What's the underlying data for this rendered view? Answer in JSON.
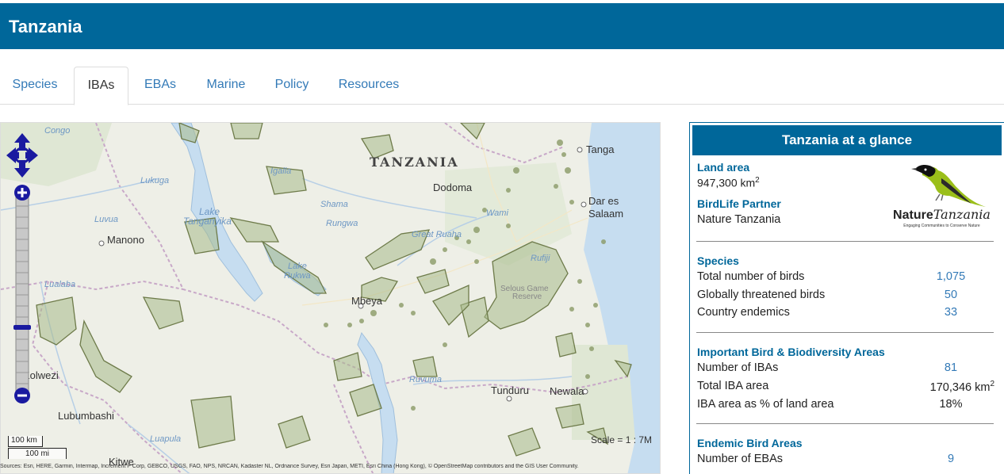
{
  "header": {
    "title": "Tanzania"
  },
  "tabs": [
    {
      "label": "Species",
      "active": false
    },
    {
      "label": "IBAs",
      "active": true
    },
    {
      "label": "EBAs",
      "active": false
    },
    {
      "label": "Marine",
      "active": false
    },
    {
      "label": "Policy",
      "active": false
    },
    {
      "label": "Resources",
      "active": false
    }
  ],
  "map": {
    "labels": {
      "country": "TANZANIA",
      "dodoma": "Dodoma",
      "tanga": "Tanga",
      "dar1": "Dar es",
      "dar2": "Salaam",
      "manono": "Manono",
      "mbeya": "Mbeya",
      "tunduru": "Tunduru",
      "newala": "Newala",
      "kolwezi": "Kolwezi",
      "lubumbashi": "Lubumbashi",
      "kitwe": "Kitwe",
      "lake_tanganyika1": "Lake",
      "lake_tanganyika2": "Tanganyika",
      "lake_rukwa1": "Lake",
      "lake_rukwa2": "Rukwa",
      "selous1": "Selous Game",
      "selous2": "Reserve",
      "lukuga": "Lukuga",
      "luvua": "Luvua",
      "igalla": "Igalla",
      "shama": "Shama",
      "rungwa": "Rungwa",
      "great_ruaha": "Great Ruaha",
      "wami": "Wami",
      "rufiji": "Rufiji",
      "ruvuma": "Ruvuma",
      "luapula": "Luapula",
      "lualaba": "Lualaba",
      "congo": "Congo"
    },
    "scale_km": "100 km",
    "scale_mi": "100 mi",
    "scale_text": "Scale = 1 : 7M",
    "attribution": "Sources: Esri, HERE, Garmin, Intermap, Increment P Corp, GEBCO, USGS, FAO, NPS, NRCAN, Kadaster NL, Ordnance Survey, Esri Japan, METI, Esri China (Hong Kong), © OpenStreetMap contributors and the GIS User Community."
  },
  "glance": {
    "title": "Tanzania at a glance",
    "land_area_label": "Land area",
    "land_area_value": "947,300 km",
    "land_area_unit_sup": "2",
    "partner_label": "BirdLife Partner",
    "partner_name": "Nature Tanzania",
    "logo": {
      "brand_bold": "Nature",
      "brand_italic": "Tanzania",
      "tagline": "Engaging Communities to Conserve Nature",
      "icon": "bird-icon"
    },
    "species": {
      "heading": "Species",
      "rows": [
        {
          "label": "Total number of birds",
          "value": "1,075"
        },
        {
          "label": "Globally threatened birds",
          "value": "50"
        },
        {
          "label": "Country endemics",
          "value": "33"
        }
      ]
    },
    "ibas": {
      "heading": "Important Bird & Biodiversity Areas",
      "rows": [
        {
          "label": "Number of IBAs",
          "value": "81"
        },
        {
          "label": "Total IBA area",
          "value": "170,346 km",
          "sup": "2"
        },
        {
          "label": "IBA area as % of land area",
          "value": "18%"
        }
      ]
    },
    "ebas": {
      "heading": "Endemic Bird Areas",
      "rows": [
        {
          "label": "Number of EBAs",
          "value": "9"
        }
      ]
    }
  },
  "colors": {
    "header_bg": "#00679a",
    "link": "#337ab7",
    "iba_fill": "#a8b98a",
    "iba_stroke": "#6e7b4a",
    "water": "#c6ddf0",
    "land": "#eeefe7",
    "zoom_control": "#1a1aa0"
  }
}
